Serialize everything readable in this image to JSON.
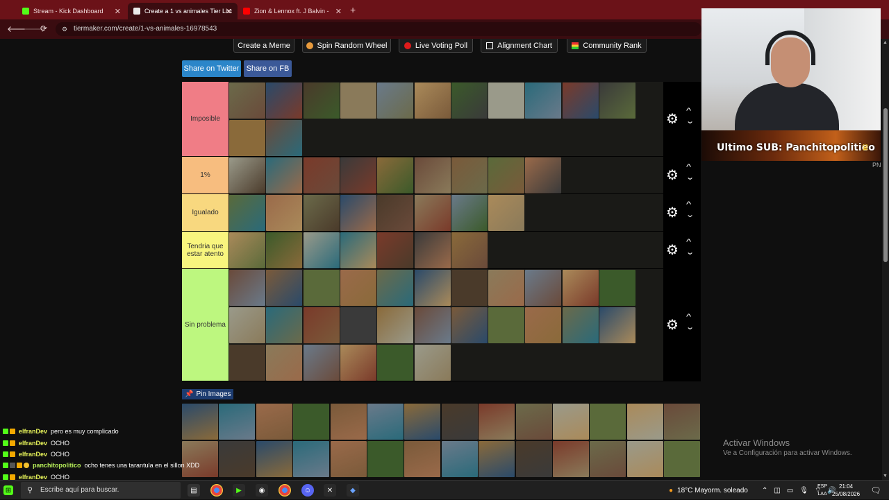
{
  "browser": {
    "tabs": [
      {
        "label": "Stream - Kick Dashboard",
        "fav_color": "#53fc18"
      },
      {
        "label": "Create a 1 vs animales Tier List",
        "fav_color": "#e9e9e9"
      },
      {
        "label": "Zion & Lennox ft. J Balvin -",
        "fav_color": "#ff0000"
      }
    ],
    "url": "tiermaker.com/create/1-vs-animales-16978543"
  },
  "top_buttons": [
    {
      "label": "Create a Meme",
      "icon": "none"
    },
    {
      "label": "Spin Random Wheel",
      "icon": "wheel-icon"
    },
    {
      "label": "Live Voting Poll",
      "icon": "red-dot-icon"
    },
    {
      "label": "Alignment Chart",
      "icon": "grid-icon"
    },
    {
      "label": "Community Rank",
      "icon": "rank-icon"
    }
  ],
  "share": {
    "twitter": "Share on Twitter",
    "fb": "Share on FB"
  },
  "tiers": [
    {
      "label": "Imposible",
      "color": "#f07d86",
      "count": 13
    },
    {
      "label": "1%",
      "color": "#f7bd7f",
      "count": 9
    },
    {
      "label": "Igualado",
      "color": "#f8d87f",
      "count": 8
    },
    {
      "label": "Tendria que estar atento",
      "color": "#f8f57e",
      "count": 7
    },
    {
      "label": "Sin problema",
      "color": "#bdf77f",
      "count": 28
    }
  ],
  "pin_label": "Pin Images",
  "pool_count": 28,
  "stream": {
    "sub_text": "Ultimo SUB: Panchitopolitieo",
    "pn": "PN"
  },
  "watermark": {
    "line1": "Activar Windows",
    "line2": "Ve a Configuración para activar Windows."
  },
  "chat": [
    {
      "user": "elfranDev",
      "text": "pero es muy complicado",
      "user_color": "#e8f55a"
    },
    {
      "user": "elfranDev",
      "text": "OCHO",
      "user_color": "#e8f55a"
    },
    {
      "user": "elfranDev",
      "text": "OCHO",
      "user_color": "#e8f55a"
    },
    {
      "user": "panchitopolitico",
      "text": "ocho tenes una tarantula en el sillon XDD",
      "user_color": "#b9f25a"
    },
    {
      "user": "elfranDev",
      "text": "OCHO",
      "user_color": "#e8f55a"
    }
  ],
  "taskbar": {
    "search_placeholder": "Escribe aquí para buscar.",
    "weather": "18°C  Mayorm. soleado",
    "lang1": "ESP",
    "lang2": "LAA",
    "time": "21:04",
    "date": "25/08/2026"
  }
}
